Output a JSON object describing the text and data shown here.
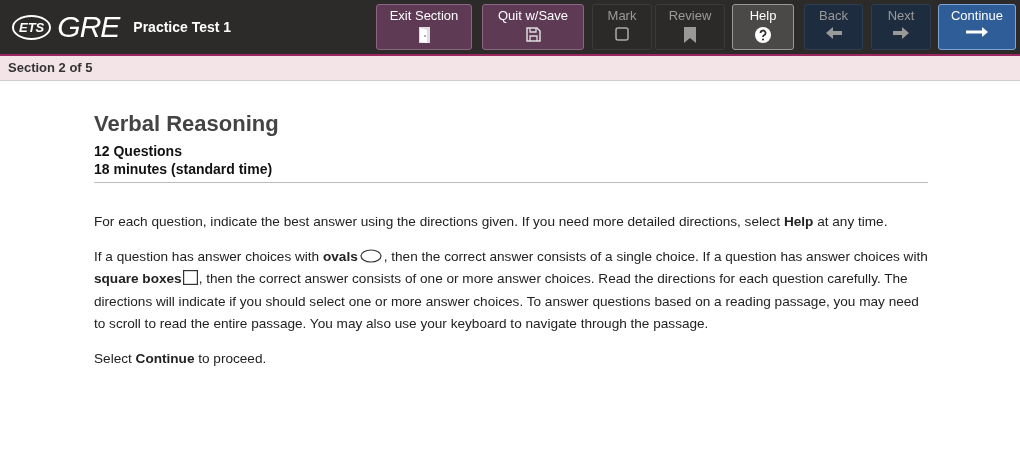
{
  "header": {
    "logo_mark": "ETS",
    "logo_text": "GRE",
    "title": "Practice Test 1"
  },
  "buttons": [
    {
      "label": "Exit Section",
      "kind": "exit",
      "disabled": false
    },
    {
      "label": "Quit w/Save",
      "kind": "exit",
      "disabled": false
    },
    {
      "label": "Mark",
      "kind": "tool",
      "disabled": true
    },
    {
      "label": "Review",
      "kind": "tool",
      "disabled": true
    },
    {
      "label": "Help",
      "kind": "help",
      "disabled": false
    },
    {
      "label": "Back",
      "kind": "nav",
      "disabled": true
    },
    {
      "label": "Next",
      "kind": "nav",
      "disabled": true
    },
    {
      "label": "Continue",
      "kind": "primary",
      "disabled": false
    }
  ],
  "section_bar": {
    "text": "Section 2 of 5"
  },
  "content": {
    "title": "Verbal Reasoning",
    "questions": "12 Questions",
    "time": "18 minutes (standard time)",
    "paragraphs": [
      {
        "segments": [
          "For each question, indicate the best answer using the directions given. If you need more detailed directions, select **Help** at any time."
        ]
      },
      {
        "segments": [
          "If a question has answer choices with **ovals**",
          ", then the correct answer consists of a single choice. If a question has answer choices with **square boxes**",
          ", then the correct answer consists of one or more answer choices. Read the directions for each question carefully. The directions will indicate if you should select one or more answer choices. To answer questions based on a reading passage, you may need to scroll to read the entire passage. You may also use your keyboard to navigate through the passage."
        ]
      },
      {
        "segments": [
          "Select **Continue** to proceed."
        ]
      }
    ]
  }
}
